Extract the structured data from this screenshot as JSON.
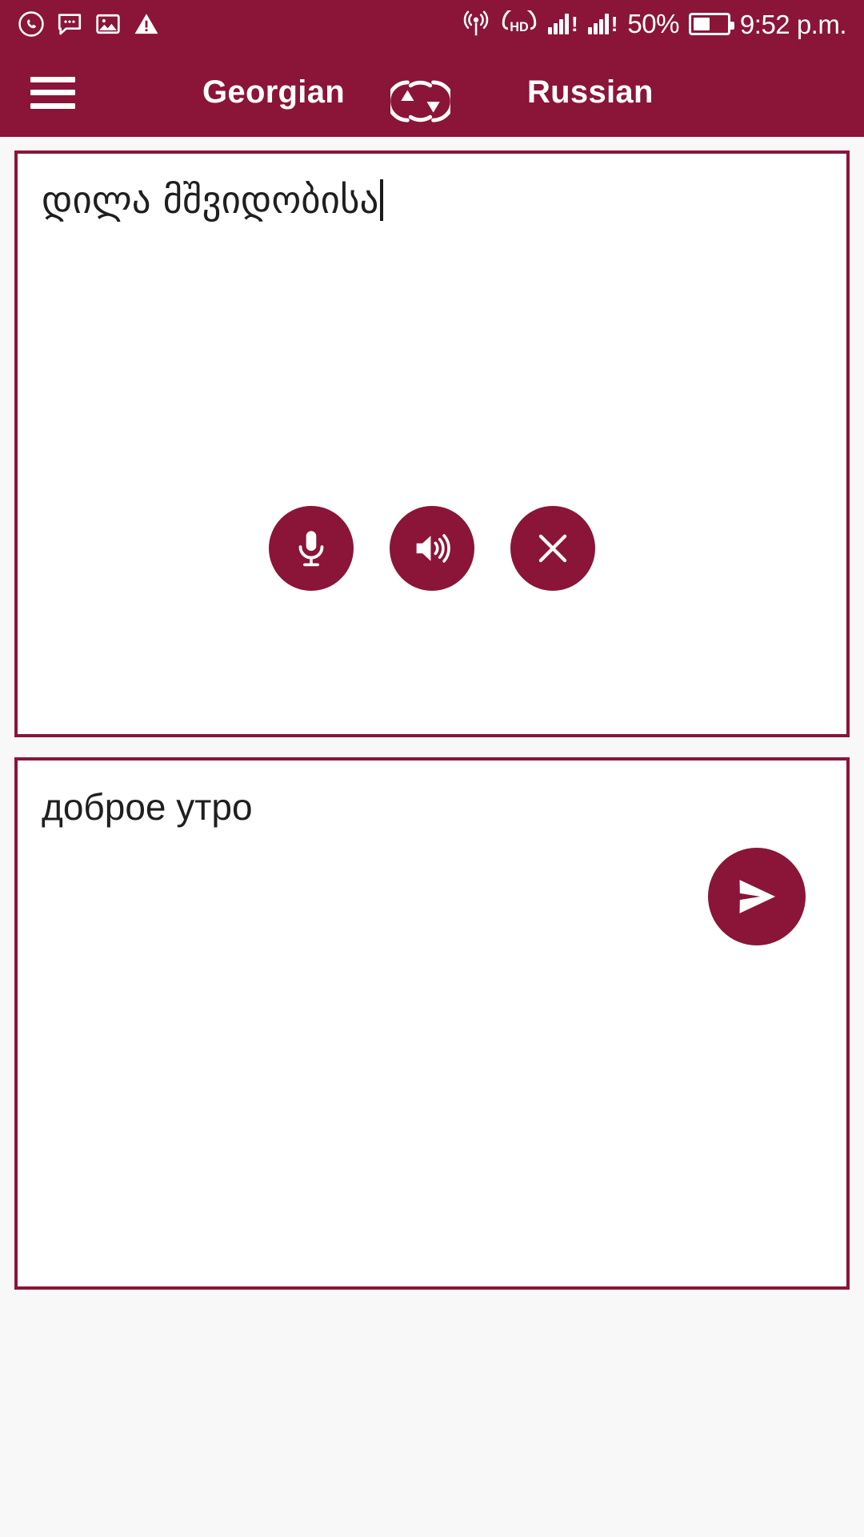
{
  "status_bar": {
    "time": "9:52 p.m.",
    "battery_percent": "50%",
    "battery_level": 50,
    "hd_label": "HD",
    "left_icons": [
      "whatsapp-icon",
      "message-icon",
      "image-icon",
      "warning-icon"
    ],
    "right_icons": [
      "hotspot-icon",
      "hd-icon",
      "signal-bars-sim1-icon",
      "signal-bars-sim2-icon",
      "battery-icon"
    ],
    "background_color": "#8a1538",
    "foreground_color": "#ffffff"
  },
  "header": {
    "menu_icon": "hamburger-menu-icon",
    "source_language": "Georgian",
    "swap_icon": "swap-languages-icon",
    "target_language": "Russian",
    "background_color": "#8a1538"
  },
  "source_box": {
    "text": "დილა მშვიდობისა",
    "has_caret": true,
    "border_color": "#8a1538",
    "background_color": "#ffffff"
  },
  "target_box": {
    "text": "доброе утро",
    "border_color": "#8a1538",
    "background_color": "#ffffff"
  },
  "actions": {
    "buttons": [
      {
        "name": "microphone-button",
        "icon": "microphone-icon",
        "label": "Speak"
      },
      {
        "name": "speaker-button",
        "icon": "speaker-icon",
        "label": "Listen"
      },
      {
        "name": "clear-button",
        "icon": "close-icon",
        "label": "Clear"
      }
    ],
    "button_color": "#8a1538"
  },
  "fab": {
    "name": "translate-send-button",
    "icon": "send-icon",
    "color": "#8a1538"
  },
  "page": {
    "background_color": "#f8f8f9",
    "accent_color": "#8a1538"
  }
}
